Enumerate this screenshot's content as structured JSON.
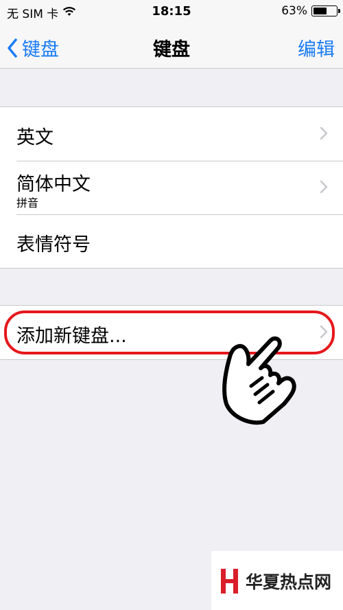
{
  "status_bar": {
    "carrier": "无 SIM 卡",
    "time": "18:15",
    "battery_percent": "63%",
    "battery_level": 0.63
  },
  "nav": {
    "back_label": "键盘",
    "title": "键盘",
    "edit_label": "编辑"
  },
  "keyboards": [
    {
      "label": "英文",
      "sublabel": ""
    },
    {
      "label": "简体中文",
      "sublabel": "拼音"
    },
    {
      "label": "表情符号",
      "sublabel": ""
    }
  ],
  "add_keyboard": {
    "label": "添加新键盘..."
  },
  "watermark": {
    "text": "华夏热点网"
  },
  "colors": {
    "accent": "#1a7cf5",
    "highlight": "#e5181c",
    "background": "#efeff4"
  }
}
